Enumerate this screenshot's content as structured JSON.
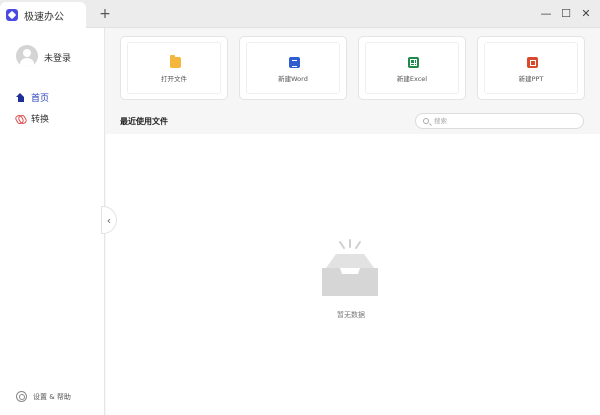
{
  "titlebar": {
    "tab_title": "极速办公",
    "new_tab": "+",
    "minimize": "—",
    "maximize": "☐",
    "close": "✕"
  },
  "sidebar": {
    "login": "未登录",
    "nav": [
      {
        "label": "首页",
        "icon": "home-icon"
      },
      {
        "label": "转换",
        "icon": "convert-icon"
      }
    ],
    "settings": "设置 & 帮助",
    "collapse": "‹"
  },
  "cards": [
    {
      "label": "打开文件",
      "icon": "folder-icon",
      "color": "#f4b73b"
    },
    {
      "label": "新建Word",
      "icon": "word-icon",
      "color": "#2f5fcf"
    },
    {
      "label": "新建Excel",
      "icon": "excel-icon",
      "color": "#1f8a4a"
    },
    {
      "label": "新建PPT",
      "icon": "ppt-icon",
      "color": "#d9492c"
    }
  ],
  "recent": {
    "title": "最近使用文件",
    "search_placeholder": "搜索",
    "empty_text": "暂无数据"
  },
  "colors": {
    "accent": "#2a3eb8",
    "background": "#f6f6f6"
  }
}
